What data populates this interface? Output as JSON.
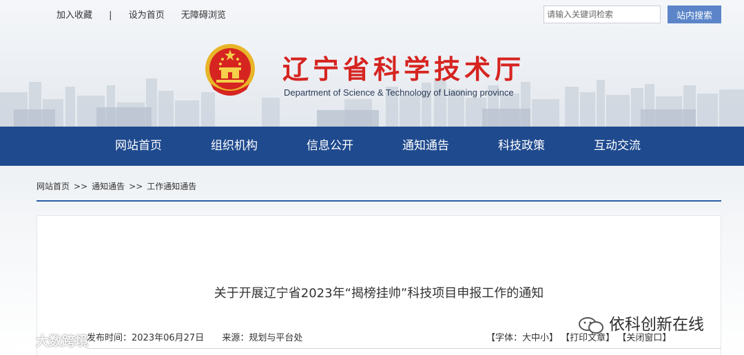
{
  "topbar": {
    "links": [
      "加入收藏",
      "设为首页",
      "无障碍浏览"
    ],
    "separator": "|"
  },
  "search": {
    "placeholder": "请输入关键词检索",
    "button_label": "站内搜索"
  },
  "site": {
    "title": "辽宁省科学技术厅",
    "subtitle": "Department of Science & Technology of Liaoning province"
  },
  "nav": {
    "items": [
      "网站首页",
      "组织机构",
      "信息公开",
      "通知通告",
      "科技政策",
      "互动交流"
    ]
  },
  "breadcrumb": {
    "items": [
      "网站首页",
      "通知通告",
      "工作通知通告"
    ],
    "separator": ">>"
  },
  "article": {
    "title": "关于开展辽宁省2023年“揭榜挂帅”科技项目申报工作的通知",
    "publish_label": "发布时间：2023年06月27日",
    "source_label": "来源：规划与平台处",
    "font_size_label": "【字体：大中小】",
    "print_label": "【打印文章】",
    "close_label": "【关闭窗口】"
  },
  "watermarks": {
    "left": "大数跨境",
    "right": "依科创新在线"
  },
  "colors": {
    "nav_bg": "#1f4a8e",
    "title_red": "#d62420",
    "search_button": "#5b85c8",
    "breadcrumb_line": "#2a5ca6"
  }
}
